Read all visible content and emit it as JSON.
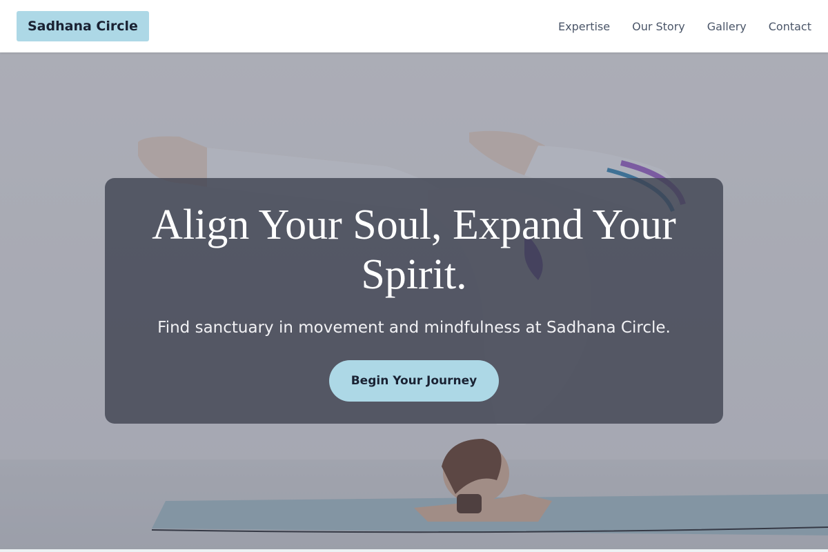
{
  "brand": {
    "name": "Sadhana Circle",
    "accent": "#add8e6"
  },
  "nav": {
    "items": [
      {
        "label": "Expertise"
      },
      {
        "label": "Our Story"
      },
      {
        "label": "Gallery"
      },
      {
        "label": "Contact"
      }
    ]
  },
  "hero": {
    "headline": "Align Your Soul, Expand Your Spirit.",
    "subtitle": "Find sanctuary in movement and mindfulness at Sadhana Circle.",
    "cta_label": "Begin Your Journey",
    "image": "yoga-headstand-photo"
  }
}
